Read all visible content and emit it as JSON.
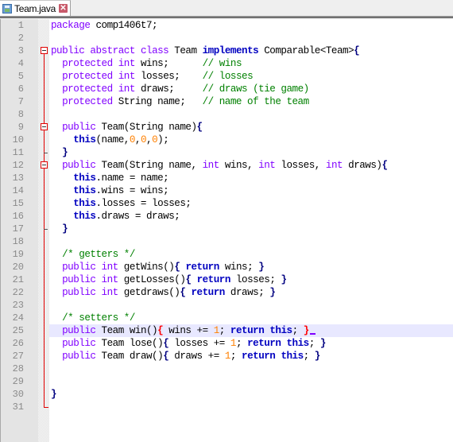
{
  "tab": {
    "filename": "Team.java",
    "icon": "save-icon",
    "close_icon": "close-icon",
    "close_glyph": "✕"
  },
  "editor": {
    "current_line": 25,
    "lines": [
      {
        "n": "1",
        "html": "<span class=\"kw\">package</span> comp1406t7;"
      },
      {
        "n": "2",
        "html": ""
      },
      {
        "n": "3",
        "html": "<span class=\"kw\">public</span> <span class=\"kw\">abstract</span> <span class=\"kw\">class</span> Team <span class=\"kw2\">implements</span> Comparable&lt;Team&gt;<span class=\"op\">{</span>"
      },
      {
        "n": "4",
        "html": "  <span class=\"kw\">protected</span> <span class=\"kw\">int</span> wins;      <span class=\"cm\">// wins</span>"
      },
      {
        "n": "5",
        "html": "  <span class=\"kw\">protected</span> <span class=\"kw\">int</span> losses;    <span class=\"cm\">// losses</span>"
      },
      {
        "n": "6",
        "html": "  <span class=\"kw\">protected</span> <span class=\"kw\">int</span> draws;     <span class=\"cm\">// draws (tie game)</span>"
      },
      {
        "n": "7",
        "html": "  <span class=\"kw\">protected</span> String name;   <span class=\"cm\">// name of the team</span>"
      },
      {
        "n": "8",
        "html": ""
      },
      {
        "n": "9",
        "html": "  <span class=\"kw\">public</span> Team(String name)<span class=\"op\">{</span>"
      },
      {
        "n": "10",
        "html": "    <span class=\"kw2\">this</span>(name,<span class=\"num\">0</span>,<span class=\"num\">0</span>,<span class=\"num\">0</span>);"
      },
      {
        "n": "11",
        "html": "  <span class=\"op\">}</span>"
      },
      {
        "n": "12",
        "html": "  <span class=\"kw\">public</span> Team(String name, <span class=\"kw\">int</span> wins, <span class=\"kw\">int</span> losses, <span class=\"kw\">int</span> draws)<span class=\"op\">{</span>"
      },
      {
        "n": "13",
        "html": "    <span class=\"kw2\">this</span>.name = name;"
      },
      {
        "n": "14",
        "html": "    <span class=\"kw2\">this</span>.wins = wins;"
      },
      {
        "n": "15",
        "html": "    <span class=\"kw2\">this</span>.losses = losses;"
      },
      {
        "n": "16",
        "html": "    <span class=\"kw2\">this</span>.draws = draws;"
      },
      {
        "n": "17",
        "html": "  <span class=\"op\">}</span>"
      },
      {
        "n": "18",
        "html": ""
      },
      {
        "n": "19",
        "html": "  <span class=\"cm\">/* getters */</span>"
      },
      {
        "n": "20",
        "html": "  <span class=\"kw\">public</span> <span class=\"kw\">int</span> getWins()<span class=\"op\">{</span> <span class=\"kw2\">return</span> wins; <span class=\"op\">}</span>"
      },
      {
        "n": "21",
        "html": "  <span class=\"kw\">public</span> <span class=\"kw\">int</span> getLosses()<span class=\"op\">{</span> <span class=\"kw2\">return</span> losses; <span class=\"op\">}</span>"
      },
      {
        "n": "22",
        "html": "  <span class=\"kw\">public</span> <span class=\"kw\">int</span> getdraws()<span class=\"op\">{</span> <span class=\"kw2\">return</span> draws; <span class=\"op\">}</span>"
      },
      {
        "n": "23",
        "html": ""
      },
      {
        "n": "24",
        "html": "  <span class=\"cm\">/* setters */</span>"
      },
      {
        "n": "25",
        "html": "  <span class=\"kw\">public</span> Team win()<span class=\"br-hl\">{</span> wins += <span class=\"num\">1</span>; <span class=\"kw2\">return</span> <span class=\"kw2\">this</span>; <span class=\"br-hl\">}</span><span class=\"caret\"></span>"
      },
      {
        "n": "26",
        "html": "  <span class=\"kw\">public</span> Team lose()<span class=\"op\">{</span> losses += <span class=\"num\">1</span>; <span class=\"kw2\">return</span> <span class=\"kw2\">this</span>; <span class=\"op\">}</span>"
      },
      {
        "n": "27",
        "html": "  <span class=\"kw\">public</span> Team draw()<span class=\"op\">{</span> draws += <span class=\"num\">1</span>; <span class=\"kw2\">return</span> <span class=\"kw2\">this</span>; <span class=\"op\">}</span>"
      },
      {
        "n": "28",
        "html": ""
      },
      {
        "n": "29",
        "html": ""
      },
      {
        "n": "30",
        "html": "<span class=\"op\">}</span>"
      },
      {
        "n": "31",
        "html": ""
      }
    ]
  }
}
